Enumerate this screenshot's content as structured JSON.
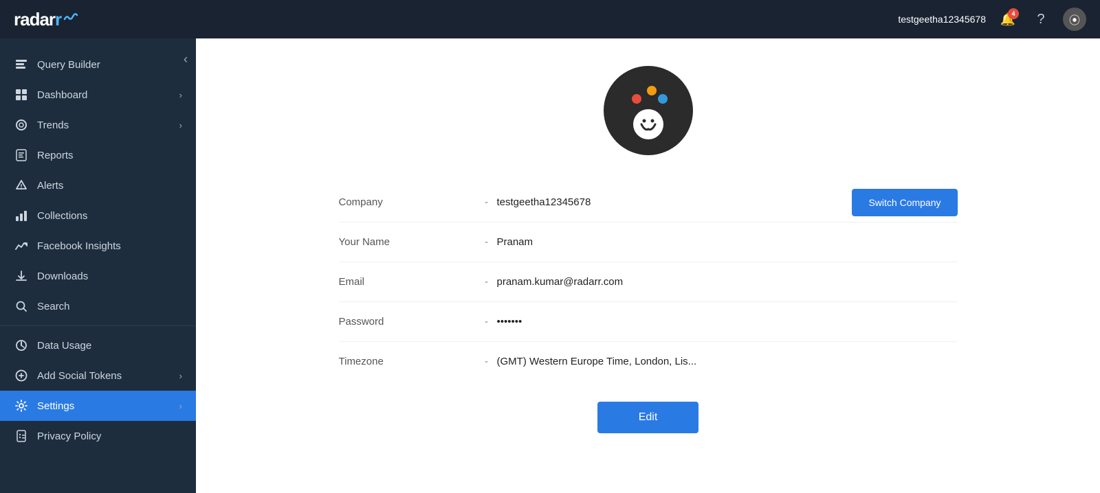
{
  "app": {
    "name": "radarr"
  },
  "topnav": {
    "username": "testgeetha12345678",
    "notification_count": "4",
    "notification_label": "Notifications",
    "help_label": "Help",
    "avatar_label": "User Avatar"
  },
  "sidebar": {
    "collapse_label": "Collapse sidebar",
    "items": [
      {
        "id": "query-builder",
        "label": "Query Builder",
        "icon": "≡",
        "has_arrow": false,
        "active": false
      },
      {
        "id": "dashboard",
        "label": "Dashboard",
        "icon": "⊞",
        "has_arrow": true,
        "active": false
      },
      {
        "id": "trends",
        "label": "Trends",
        "icon": "◈",
        "has_arrow": true,
        "active": false
      },
      {
        "id": "reports",
        "label": "Reports",
        "icon": "📋",
        "has_arrow": false,
        "active": false
      },
      {
        "id": "alerts",
        "label": "Alerts",
        "icon": "⚠",
        "has_arrow": false,
        "active": false
      },
      {
        "id": "collections",
        "label": "Collections",
        "icon": "📊",
        "has_arrow": false,
        "active": false
      },
      {
        "id": "facebook-insights",
        "label": "Facebook Insights",
        "icon": "📈",
        "has_arrow": false,
        "active": false
      },
      {
        "id": "downloads",
        "label": "Downloads",
        "icon": "⬇",
        "has_arrow": false,
        "active": false
      },
      {
        "id": "search",
        "label": "Search",
        "icon": "🔍",
        "has_arrow": false,
        "active": false
      },
      {
        "id": "data-usage",
        "label": "Data Usage",
        "icon": "◎",
        "has_arrow": false,
        "active": false
      },
      {
        "id": "add-social-tokens",
        "label": "Add Social Tokens",
        "icon": "⊕",
        "has_arrow": true,
        "active": false
      },
      {
        "id": "settings",
        "label": "Settings",
        "icon": "⚙",
        "has_arrow": true,
        "active": true
      },
      {
        "id": "privacy-policy",
        "label": "Privacy Policy",
        "icon": "🔒",
        "has_arrow": false,
        "active": false
      }
    ]
  },
  "profile": {
    "company_label": "Company",
    "company_value": "testgeetha12345678",
    "name_label": "Your Name",
    "name_value": "Pranam",
    "email_label": "Email",
    "email_value": "pranam.kumar@radarr.com",
    "password_label": "Password",
    "password_value": "•••••••",
    "timezone_label": "Timezone",
    "timezone_value": "(GMT) Western Europe Time, London, Lis...",
    "dash": "-",
    "switch_company_label": "Switch Company",
    "edit_label": "Edit"
  },
  "logo_dots": [
    {
      "color": "#4db8ff"
    },
    {
      "color": "#4db8ff"
    },
    {
      "color": "#4db8ff"
    }
  ]
}
